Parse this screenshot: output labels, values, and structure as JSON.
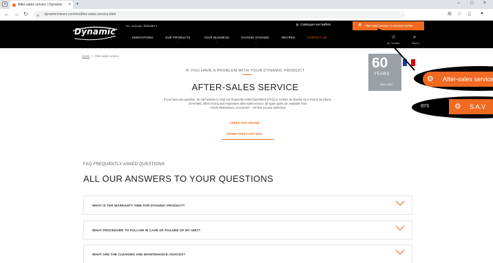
{
  "browser": {
    "tab_title": "After-sales service | Dynamic",
    "tab_close": "×",
    "new_tab": "+",
    "url": "dynamicmixers.com/en/after-sales-service.html"
  },
  "header": {
    "logo_text": "Dynamic",
    "logo_sub": "",
    "lang_label": "Your language",
    "lang_value": "ENGLISH",
    "catalog": "Catalogues and leaflets",
    "aftersales": "After-sales service / Customer Center",
    "menu": [
      "INNOVATIONS",
      "OUR PRODUCTS",
      "YOUR BUSINESS",
      "CHOOSE DYNAMIC",
      "RECIPES",
      "CONTACT US"
    ],
    "my_favorites": "My favorites",
    "search": "Search"
  },
  "breadcrumb": {
    "home": "Home",
    "sep": ">",
    "current": "After-sales service"
  },
  "badge": {
    "number": "60",
    "years": "YEARS",
    "since": "Since 1964"
  },
  "hero": {
    "pretitle": "IF YOU HAVE A PROBLEM WITH YOUR DYNAMIC PRODUCT",
    "title": "AFTER-SALES SERVICE",
    "desc1": "If you have any question, do not hesitate to read our frequently Asked Questions (FAQ) or contact us directly via e-mail or by phone.",
    "desc2": "DYNAMIC offers strong and responsive after-sales service, all spare parts are available from",
    "desc3": "YOUR PERSONAL ACCOUNT – AFTER SALES SERVICE",
    "cta1": "CHECK OUT ONLINE",
    "cta2": "SPARE PARTS LIST 2024"
  },
  "faq": {
    "pretitle": "FAQ FREQUENTLY ASKED QUESTIONS",
    "title": "ALL OUR ANSWERS TO YOUR QUESTIONS",
    "questions": [
      "WHAT IS THE WARRANTY TIME FOR DYNAMIC PRODUCT?",
      "WHAT PROCEDURE TO FOLLOW IN CASE OF FAILURE OF MY UNIT?",
      "WHAT ARE THE CLEANING AND MAINTENANCE ADVICES?"
    ]
  },
  "callouts": {
    "zoom1": "After-sales service",
    "zoom2_left": "ers",
    "zoom2": "S.A.V"
  },
  "colors": {
    "accent": "#f06a22",
    "header_bg": "#000000"
  }
}
